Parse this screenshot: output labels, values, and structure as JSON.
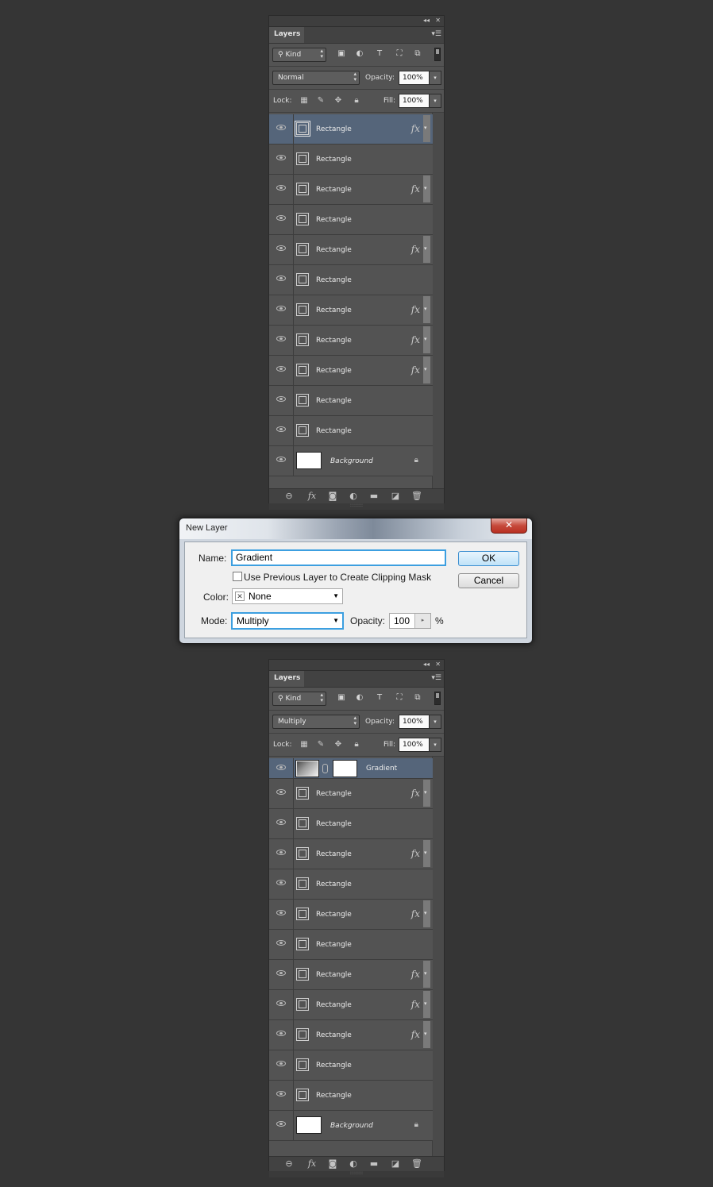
{
  "panel_top": {
    "tab_label": "Layers",
    "filter_kind": "Kind",
    "blend_mode": "Normal",
    "opacity_label": "Opacity:",
    "opacity_value": "100%",
    "lock_label": "Lock:",
    "fill_label": "Fill:",
    "fill_value": "100%",
    "layers": [
      {
        "name": "Rectangle",
        "fx": "fx"
      },
      {
        "name": "Rectangle",
        "fx": ""
      },
      {
        "name": "Rectangle",
        "fx": "fx"
      },
      {
        "name": "Rectangle",
        "fx": ""
      },
      {
        "name": "Rectangle",
        "fx": "fx"
      },
      {
        "name": "Rectangle",
        "fx": ""
      },
      {
        "name": "Rectangle",
        "fx": "fx"
      },
      {
        "name": "Rectangle",
        "fx": "fx"
      },
      {
        "name": "Rectangle",
        "fx": "fx"
      },
      {
        "name": "Rectangle",
        "fx": ""
      },
      {
        "name": "Rectangle",
        "fx": ""
      }
    ],
    "background_name": "Background"
  },
  "dialog": {
    "title": "New Layer",
    "close_glyph": "✕",
    "name_label": "Name:",
    "name_value": "Gradient",
    "clip_label": "Use Previous Layer to Create Clipping Mask",
    "color_label": "Color:",
    "color_value": "None",
    "mode_label": "Mode:",
    "mode_value": "Multiply",
    "opacity_label": "Opacity:",
    "opacity_value": "100",
    "percent": "%",
    "ok_label": "OK",
    "cancel_label": "Cancel"
  },
  "panel_bottom": {
    "tab_label": "Layers",
    "filter_kind": "Kind",
    "blend_mode": "Multiply",
    "opacity_label": "Opacity:",
    "opacity_value": "100%",
    "lock_label": "Lock:",
    "fill_label": "Fill:",
    "fill_value": "100%",
    "gradient_layer_name": "Gradient",
    "layers": [
      {
        "name": "Rectangle",
        "fx": "fx"
      },
      {
        "name": "Rectangle",
        "fx": ""
      },
      {
        "name": "Rectangle",
        "fx": "fx"
      },
      {
        "name": "Rectangle",
        "fx": ""
      },
      {
        "name": "Rectangle",
        "fx": "fx"
      },
      {
        "name": "Rectangle",
        "fx": ""
      },
      {
        "name": "Rectangle",
        "fx": "fx"
      },
      {
        "name": "Rectangle",
        "fx": "fx"
      },
      {
        "name": "Rectangle",
        "fx": "fx"
      },
      {
        "name": "Rectangle",
        "fx": ""
      },
      {
        "name": "Rectangle",
        "fx": ""
      }
    ],
    "background_name": "Background"
  },
  "colors": {
    "page_bg": "#353535",
    "panel_bg": "#535353",
    "selected_row": "#55657a",
    "focus_blue": "#3c9fe0"
  }
}
